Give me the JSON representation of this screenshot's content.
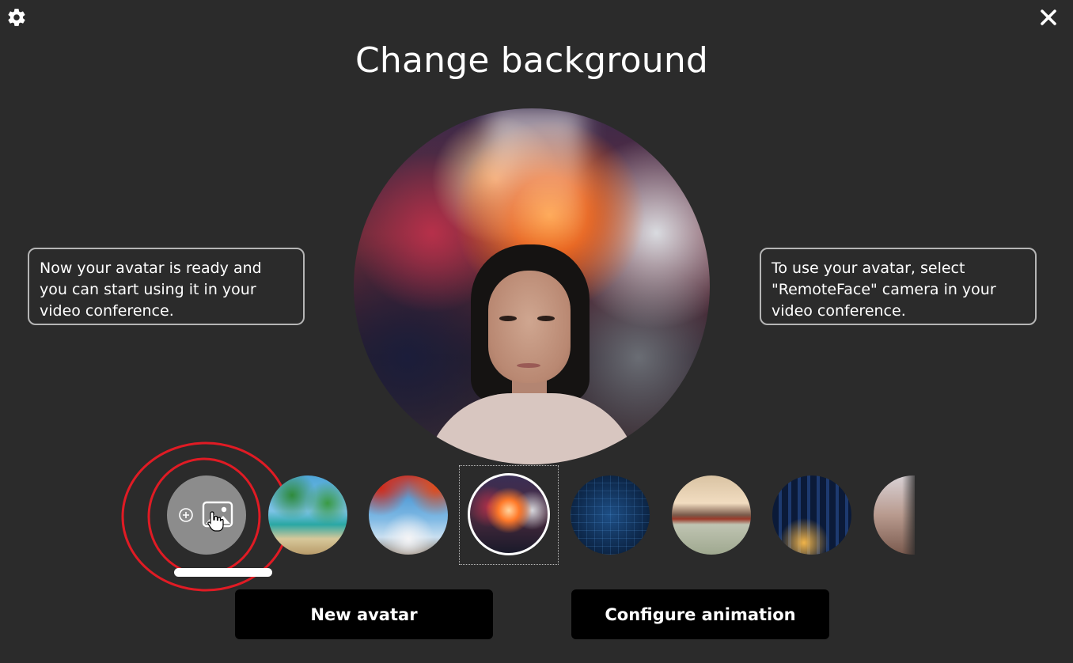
{
  "window": {
    "title": "Change background",
    "settings_icon": "gear-icon",
    "close_icon": "close-icon"
  },
  "info": {
    "left_text": "Now your avatar is ready and you can start using it in your video conference.",
    "right_text": "To use your avatar, select \"RemoteFace\" camera in your video conference."
  },
  "preview": {
    "description_icon": "avatar-preview"
  },
  "backgrounds": {
    "add_button_icons": [
      "plus-icon",
      "image-icon",
      "hand-cursor-icon"
    ],
    "items": [
      {
        "name": "tropical-beach",
        "selected": false
      },
      {
        "name": "autumn-sky",
        "selected": false
      },
      {
        "name": "fiery-clouds",
        "selected": true
      },
      {
        "name": "digital-grid",
        "selected": false
      },
      {
        "name": "palace-lake",
        "selected": false
      },
      {
        "name": "night-city",
        "selected": false
      },
      {
        "name": "interior-room",
        "selected": false
      }
    ]
  },
  "actions": {
    "new_avatar_label": "New avatar",
    "configure_animation_label": "Configure animation"
  },
  "colors": {
    "background": "#2b2b2b",
    "button": "#000000",
    "annotation": "#e01b24",
    "add_button": "#8c8c8c"
  }
}
